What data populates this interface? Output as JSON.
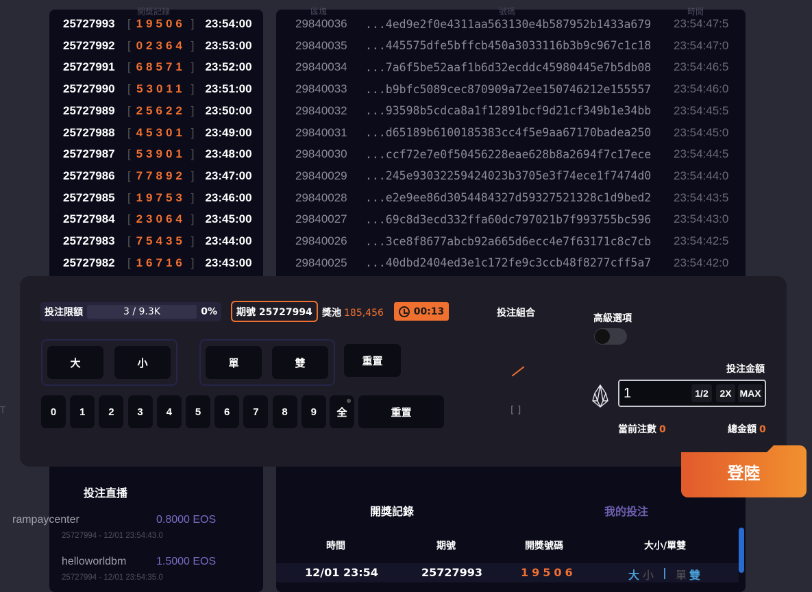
{
  "headers": {
    "draw_records": "開獎記錄",
    "block": "區塊",
    "number": "號碼",
    "time": "時間"
  },
  "draws": [
    {
      "id": "25727993",
      "nums": "19506",
      "time": "23:54:00"
    },
    {
      "id": "25727992",
      "nums": "02364",
      "time": "23:53:00"
    },
    {
      "id": "25727991",
      "nums": "68571",
      "time": "23:52:00"
    },
    {
      "id": "25727990",
      "nums": "53011",
      "time": "23:51:00"
    },
    {
      "id": "25727989",
      "nums": "25622",
      "time": "23:50:00"
    },
    {
      "id": "25727988",
      "nums": "45301",
      "time": "23:49:00"
    },
    {
      "id": "25727987",
      "nums": "53901",
      "time": "23:48:00"
    },
    {
      "id": "25727986",
      "nums": "77892",
      "time": "23:47:00"
    },
    {
      "id": "25727985",
      "nums": "19753",
      "time": "23:46:00"
    },
    {
      "id": "25727984",
      "nums": "23064",
      "time": "23:45:00"
    },
    {
      "id": "25727983",
      "nums": "75435",
      "time": "23:44:00"
    },
    {
      "id": "25727982",
      "nums": "16716",
      "time": "23:43:00"
    }
  ],
  "blocks": [
    {
      "num": "29840036",
      "hash": "...4ed9e2f0e4311aa563130e4b587952b1433a679",
      "time": "23:54:47:5"
    },
    {
      "num": "29840035",
      "hash": "...445575dfe5bffcb450a3033116b3b9c967c1c18",
      "time": "23:54:47:0"
    },
    {
      "num": "29840034",
      "hash": "...7a6f5be52aaf1b6d32ecddc45980445e7b5db08",
      "time": "23:54:46:5"
    },
    {
      "num": "29840033",
      "hash": "...b9bfc5089cec870909a72ee150746212e155557",
      "time": "23:54:46:0"
    },
    {
      "num": "29840032",
      "hash": "...93598b5cdca8a1f12891bcf9d21cf349b1e34bb",
      "time": "23:54:45:5"
    },
    {
      "num": "29840031",
      "hash": "...d65189b6100185383cc4f5e9aa67170badea250",
      "time": "23:54:45:0"
    },
    {
      "num": "29840030",
      "hash": "...ccf72e7e0f50456228eae628b8a2694f7c17ece",
      "time": "23:54:44:5"
    },
    {
      "num": "29840029",
      "hash": "...245e93032259424023b3705e3f74ece1f7474d0",
      "time": "23:54:44:0"
    },
    {
      "num": "29840028",
      "hash": "...e2e9ee86d3054484327d59327521328c1d9bed2",
      "time": "23:54:43:5"
    },
    {
      "num": "29840027",
      "hash": "...69c8d3ecd332ffa60dc797021b7f993755bc596",
      "time": "23:54:43:0"
    },
    {
      "num": "29840026",
      "hash": "...3ce8f8677abcb92a665d6ecc4e7f63171c8c7cb",
      "time": "23:54:42:5"
    },
    {
      "num": "29840025",
      "hash": "...40dbd2404ed3e1c172fe9c3ccb48f8277cff5a7",
      "time": "23:54:42:0"
    }
  ],
  "betting": {
    "limit_label": "投注限額",
    "limit_value": "3 / 9.3K",
    "limit_pct": "0%",
    "period": "期號 25727994",
    "pool_label": "獎池",
    "pool_value": "185,456",
    "timer": "00:13",
    "combo_title": "投注組合",
    "combo_empty": "[ ]",
    "big": "大",
    "small": "小",
    "odd": "單",
    "even": "雙",
    "reset": "重置",
    "digits": [
      "0",
      "1",
      "2",
      "3",
      "4",
      "5",
      "6",
      "7",
      "8",
      "9"
    ],
    "all": "全",
    "advanced": "高級選項",
    "amount_title": "投注金額",
    "amount_value": "1",
    "half": "1/2",
    "double": "2X",
    "max": "MAX",
    "current_bets_label": "當前注數",
    "current_bets_value": "0",
    "total_label": "總金額",
    "total_value": "0"
  },
  "login": "登陸",
  "live": {
    "title": "投注直播",
    "items": [
      {
        "name": "rampaycenter",
        "amount": "0.8000 EOS",
        "sub": "25727994 - 12/01 23:54:43.0"
      },
      {
        "name": "helloworldbm",
        "amount": "1.5000 EOS",
        "sub": "25727994 - 12/01 23:54:35.0"
      }
    ]
  },
  "history": {
    "tab_draws": "開獎記錄",
    "tab_mine": "我的投注",
    "col_time": "時間",
    "col_period": "期號",
    "col_number": "開獎號碼",
    "col_size": "大小/單雙",
    "row": {
      "time": "12/01 23:54",
      "period": "25727993",
      "number": "19506",
      "big": "大",
      "small": "小",
      "sep": "|",
      "odd": "單",
      "even": "雙"
    }
  },
  "side_text": "T",
  "colors": {
    "accent": "#f07030",
    "panel": "#0b0b1a",
    "purple": "#7a6cc4",
    "blue": "#2a6bd0"
  }
}
